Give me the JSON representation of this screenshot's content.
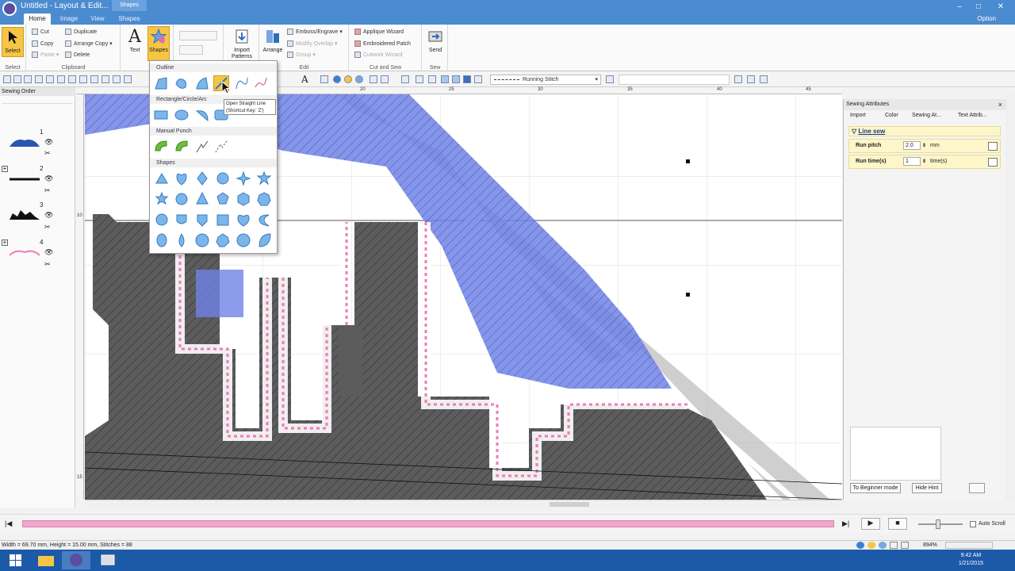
{
  "window": {
    "title": "Untitled - Layout & Edit...",
    "context_tab": "Shapes",
    "option": "Option"
  },
  "tabs": [
    {
      "label": "Home"
    },
    {
      "label": "Image"
    },
    {
      "label": "View"
    },
    {
      "label": "Shapes"
    }
  ],
  "ribbon": {
    "select_label": "Select",
    "select_group": "Select",
    "cut": "Cut",
    "copy": "Copy",
    "paste": "Paste",
    "duplicate": "Duplicate",
    "arrange_copy": "Arrange Copy",
    "delete": "Delete",
    "clipboard_group": "Clipboard",
    "text": "Text",
    "shapes": "Shapes",
    "import_patterns": "Import\nPatterns",
    "arrange": "Arrange",
    "emboss": "Emboss/Engrave",
    "modify_overlap": "Modify Overlap",
    "group": "Group",
    "edit_group": "Edit",
    "applique": "Applique Wizard",
    "embroidered_patch": "Embroidered Patch",
    "cutwork": "Cutwork Wizard",
    "cut_sew_group": "Cut and Sew",
    "send": "Send",
    "sew_group": "Sew"
  },
  "toolbar2": {
    "stitch_type": "Running Stitch"
  },
  "sewing_order": {
    "title": "Sewing Order",
    "items": [
      {
        "num": "1"
      },
      {
        "num": "2"
      },
      {
        "num": "3"
      },
      {
        "num": "4"
      }
    ]
  },
  "ruler": {
    "top": [
      "5",
      "20",
      "25",
      "30",
      "35",
      "40",
      "45"
    ],
    "left": [
      "10",
      "15"
    ]
  },
  "dropdown": {
    "outline": "Outline",
    "rect": "Rectangle/Circle/Arc",
    "manual": "Manual Punch",
    "shapes": "Shapes"
  },
  "tooltip": {
    "line1": "Open Straight Line",
    "line2": "(Shortcut Key: 'Z')"
  },
  "sewing_attributes": {
    "title": "Sewing Attributes",
    "tabs": [
      "Import",
      "Color",
      "Sewing At...",
      "Text Attrib..."
    ],
    "section": "Line sew",
    "rows": [
      {
        "label": "Run pitch",
        "value": "2.0",
        "unit": "mm"
      },
      {
        "label": "Run time(s)",
        "value": "1",
        "unit": "time(s)"
      }
    ],
    "beginner": "To Beginner mode",
    "hide_hint": "Hide Hint"
  },
  "status": {
    "text": "Width = 69.70 mm, Height = 15.00 mm, Stitches = 88",
    "zoom": "894%",
    "auto_scroll": "Auto Scroll"
  },
  "clock": {
    "time": "9:42 AM",
    "date": "1/21/2015"
  },
  "colors": {
    "title_blue": "#4b8bd0",
    "shape_blue": "#3a55c8",
    "dark_fill": "#5c5c5c",
    "pink": "#f07ab8",
    "progress_pink": "#f2a6cc"
  }
}
